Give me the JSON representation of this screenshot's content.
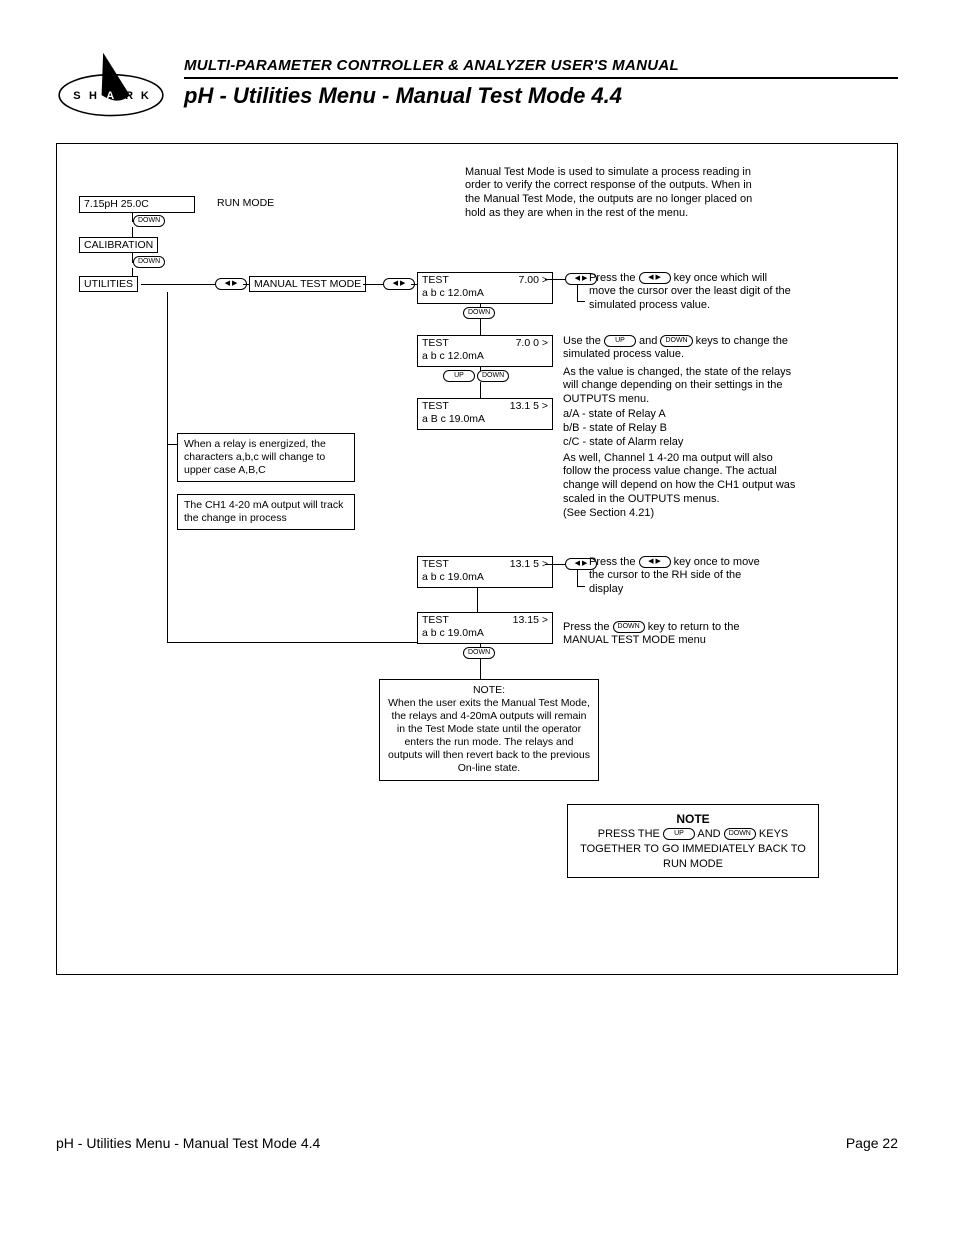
{
  "header": {
    "logo_letters": [
      "S",
      "H",
      "A",
      "R",
      "K"
    ],
    "manual_title": "MULTI-PARAMETER CONTROLLER & ANALYZER USER'S MANUAL",
    "section_title": "pH - Utilities Menu - Manual Test Mode 4.4"
  },
  "keys": {
    "up": "UP",
    "down": "DOWN",
    "lr": "◀ ▶"
  },
  "intro": "Manual Test Mode is used to simulate a process reading in order to verify the correct response of the outputs. When in the Manual Test Mode, the outputs are no longer placed on hold as they are when in the rest of the menu.",
  "left_col": {
    "screen1": "7.15pH  25.0C",
    "run_mode": "RUN MODE",
    "cal": "CALIBRATION",
    "util": "UTILITIES",
    "mtm": "MANUAL TEST MODE",
    "note_relay": "When a relay is energized, the characters a,b,c will change to upper case A,B,C",
    "note_ch1": "The CH1 4-20 mA output will track the change in process"
  },
  "mid_col": {
    "s1_l1_left": "TEST",
    "s1_l1_right": "7.00 >",
    "s1_l2": "a  b  c     12.0mA",
    "s2_l1_left": "TEST",
    "s2_l1_right": "7.0 0 >",
    "s2_l2": "a  b  c     12.0mA",
    "s3_l1_left": "TEST",
    "s3_l1_right": "13.1 5 >",
    "s3_l2": "a  B  c     19.0mA",
    "s4_l1_left": "TEST",
    "s4_l1_right": "13.1 5 >",
    "s4_l2": "a  b  c  19.0mA",
    "s5_l1_left": "TEST",
    "s5_l1_right": "13.15  >",
    "s5_l2": "a  b  c  19.0mA",
    "note_exit": "NOTE:\nWhen the user exits the Manual Test Mode, the relays and 4-20mA outputs will remain in the Test Mode state until the operator enters the run mode. The relays and outputs will then revert back to the previous On-line state."
  },
  "right_col": {
    "p1a": "Press the ",
    "p1b": " key once which will move the cursor over the least digit of the simulated process value.",
    "p2a": "Use the ",
    "p2b": " and ",
    "p2c": " keys to change the simulated process value.",
    "p3": "As the value is changed, the state of the relays will change depending on their settings in the OUTPUTS menu.",
    "p3a": "a/A - state of Relay A",
    "p3b": "b/B - state of Relay B",
    "p3c": "c/C - state of Alarm relay",
    "p4": "As well, Channel 1 4-20 ma output will also follow the process value change. The actual change will depend on how the CH1 output was scaled in the OUTPUTS menus.\n(See Section 4.21)",
    "p5a": "Press the ",
    "p5b": " key once to move the cursor  to the RH side of the display",
    "p6a": "Press the ",
    "p6b": " key to return to the MANUAL TEST MODE menu"
  },
  "big_note": {
    "heading": "NOTE",
    "l1a": "PRESS THE ",
    "l1b": " AND ",
    "l1c": "  KEYS",
    "l2": "TOGETHER TO GO IMMEDIATELY BACK TO",
    "l3": "RUN MODE"
  },
  "footer": {
    "left": "pH - Utilities Menu - Manual Test Mode 4.4",
    "right": "Page 22"
  }
}
